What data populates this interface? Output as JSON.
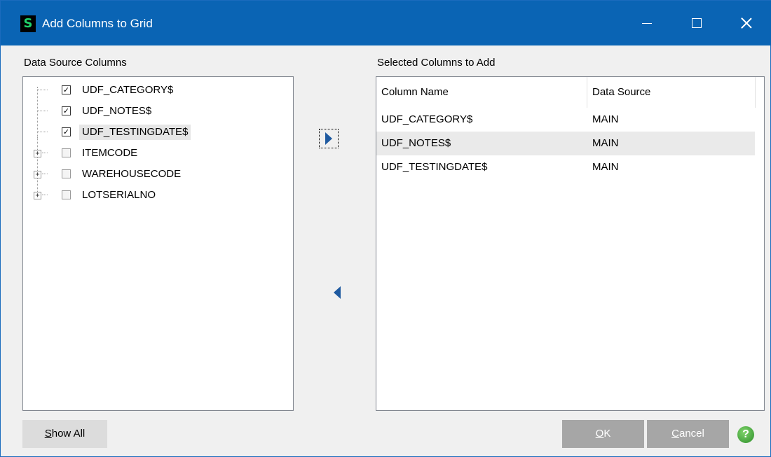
{
  "window": {
    "title": "Add Columns to Grid",
    "app_icon_text": "S"
  },
  "left_panel": {
    "label": "Data Source Columns",
    "items": [
      {
        "text": "UDF_CATEGORY$",
        "checked": true,
        "expandable": false
      },
      {
        "text": "UDF_NOTES$",
        "checked": true,
        "expandable": false
      },
      {
        "text": "UDF_TESTINGDATE$",
        "checked": true,
        "expandable": false,
        "selected": true
      },
      {
        "text": "ITEMCODE",
        "checked": false,
        "expandable": true
      },
      {
        "text": "WAREHOUSECODE",
        "checked": false,
        "expandable": true
      },
      {
        "text": "LOTSERIALNO",
        "checked": false,
        "expandable": true
      }
    ]
  },
  "right_panel": {
    "label": "Selected Columns to Add",
    "columns": [
      "Column Name",
      "Data Source"
    ],
    "rows": [
      [
        "UDF_CATEGORY$",
        "MAIN"
      ],
      [
        "UDF_NOTES$",
        "MAIN"
      ],
      [
        "UDF_TESTINGDATE$",
        "MAIN"
      ]
    ]
  },
  "buttons": {
    "show_all": {
      "prefix": "",
      "mnemonic": "S",
      "rest": "how All"
    },
    "ok": {
      "prefix": "",
      "mnemonic": "O",
      "rest": "K"
    },
    "cancel": {
      "prefix": "",
      "mnemonic": "C",
      "rest": "ancel"
    },
    "help": "?"
  },
  "icons": {
    "add": "arrow-right-icon",
    "remove": "arrow-left-icon",
    "help": "help-icon"
  },
  "colors": {
    "titlebar": "#0a64b4",
    "accent": "#1f5aa0",
    "help": "#2e8f2a"
  }
}
